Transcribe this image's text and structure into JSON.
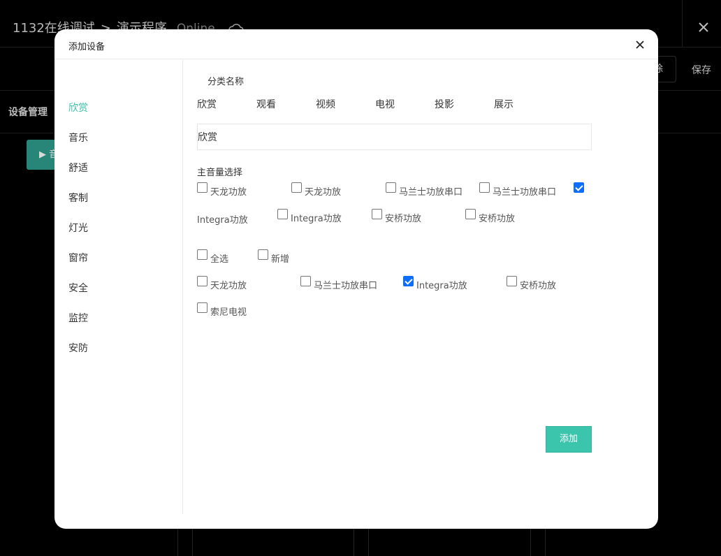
{
  "background": {
    "title": "1132在线调试",
    "breadcrumb_sep": ">",
    "program": "演示程序",
    "status": "Online",
    "cloud_icon": "cloud-icon",
    "close_icon": "close-icon",
    "delete_label": "除",
    "save_label": "保存",
    "section_title": "设备管理",
    "green_button_label": "▶ 音"
  },
  "modal": {
    "title": "添加设备",
    "close_icon": "close-icon",
    "nav": [
      {
        "label": "欣赏",
        "active": true
      },
      {
        "label": "音乐",
        "active": false
      },
      {
        "label": "舒适",
        "active": false
      },
      {
        "label": "客制",
        "active": false
      },
      {
        "label": "灯光",
        "active": false
      },
      {
        "label": "窗帘",
        "active": false
      },
      {
        "label": "安全",
        "active": false
      },
      {
        "label": "监控",
        "active": false
      },
      {
        "label": "安防",
        "active": false
      }
    ],
    "category_label": "分类名称",
    "category_tabs": [
      "欣赏",
      "观看",
      "视频",
      "电视",
      "投影",
      "展示"
    ],
    "category_value": "欣赏",
    "master_volume_label": "主音量选择",
    "master_volume_options": [
      {
        "label": "天龙功放",
        "checked": false
      },
      {
        "label": "天龙功放",
        "checked": false
      },
      {
        "label": "马兰士功放串口",
        "checked": false
      },
      {
        "label": "马兰士功放串口",
        "checked": false
      },
      {
        "label": "",
        "checked": true
      },
      {
        "label": "Integra功放",
        "checked": false
      },
      {
        "label": "Integra功放",
        "checked": false
      },
      {
        "label": "安桥功放",
        "checked": false
      },
      {
        "label": "安桥功放",
        "checked": false
      }
    ],
    "select_all_label": "全选",
    "new_label": "新增",
    "device_options": [
      {
        "label": "天龙功放",
        "checked": false
      },
      {
        "label": "马兰士功放串口",
        "checked": false
      },
      {
        "label": "Integra功放",
        "checked": true
      },
      {
        "label": "安桥功放",
        "checked": false
      },
      {
        "label": "索尼电视",
        "checked": false
      }
    ],
    "add_button": "添加",
    "accent_color": "#3cc5ad",
    "check_color": "#0d6efd"
  }
}
